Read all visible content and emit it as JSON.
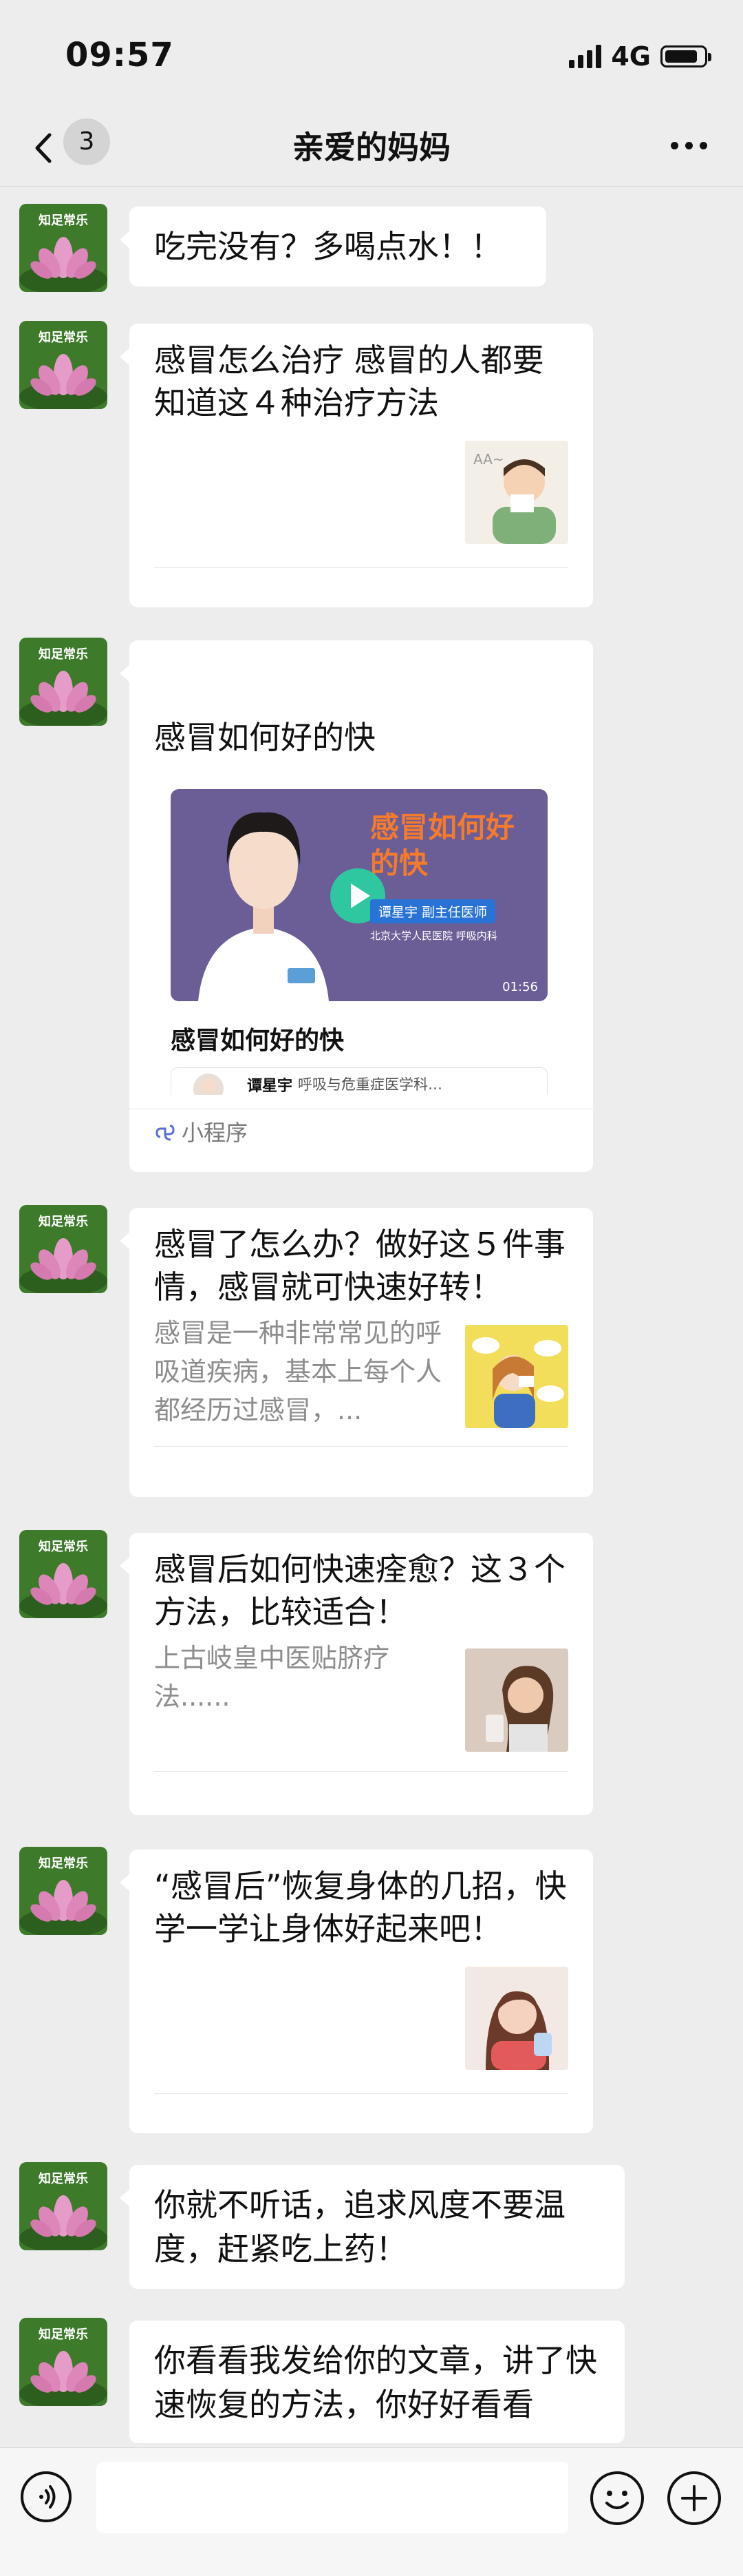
{
  "status_bar": {
    "time": "09:57",
    "network": "4G",
    "battery_level": 0.85
  },
  "nav": {
    "unread_count": "3",
    "title": "亲爱的妈妈"
  },
  "avatar_label": "知足常乐",
  "messages": {
    "m1": "吃完没有？多喝点水！！",
    "m2_title": "感冒怎么治疗 感冒的人都要知道这４种治疗方法",
    "m3": {
      "title": "感冒如何好的快",
      "video_title": "感冒如何好的快",
      "doctor_badge": "谭星宇 副主任医师",
      "affiliation": "北京大学人民医院 呼吸内科",
      "duration": "01:56",
      "card_name": "感冒如何好的快",
      "doctor_name": "谭星宇",
      "doctor_dept": "呼吸与危重症医学科…",
      "footer": "小程序"
    },
    "m4_title": "感冒了怎么办？做好这５件事情，感冒就可快速好转！",
    "m4_desc": "感冒是一种非常常见的呼吸道疾病，基本上每个人都经历过感冒，...",
    "m5_title": "感冒后如何快速痊愈？这３个方法，比较适合！",
    "m5_desc": "上古岐皇中医贴脐疗法......",
    "m6_title": "“感冒后”恢复身体的几招，快学一学让身体好起来吧！",
    "m7": "你就不听话，追求风度不要温度，赶紧吃上药！",
    "m8": "你看看我发给你的文章，讲了快速恢复的方法，你好好看看"
  },
  "colors": {
    "background": "#ededed",
    "bubble": "#ffffff",
    "play_button": "#2ec7a0",
    "video_title": "#f47a2c"
  }
}
